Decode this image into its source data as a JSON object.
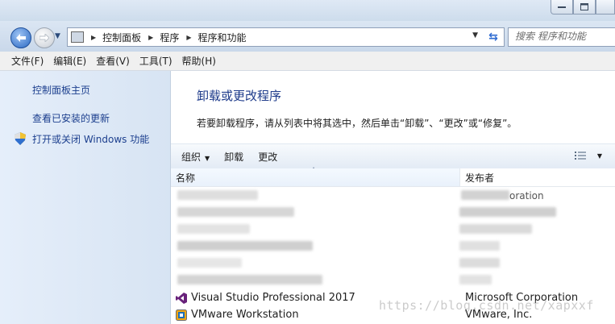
{
  "address_bar": {
    "crumbs": [
      "控制面板",
      "程序",
      "程序和功能"
    ]
  },
  "search": {
    "placeholder": "搜索 程序和功能"
  },
  "menu": [
    "文件(F)",
    "编辑(E)",
    "查看(V)",
    "工具(T)",
    "帮助(H)"
  ],
  "sidebar": {
    "items": [
      {
        "label": "控制面板主页"
      },
      {
        "label": "查看已安装的更新"
      },
      {
        "label": "打开或关闭 Windows 功能"
      }
    ]
  },
  "main": {
    "title": "卸载或更改程序",
    "description": "若要卸载程序，请从列表中将其选中，然后单击“卸载”、“更改”或“修复”。"
  },
  "toolbar": {
    "organize": "组织",
    "uninstall": "卸载",
    "change": "更改"
  },
  "columns": {
    "name": "名称",
    "publisher": "发布者"
  },
  "programs": [
    {
      "name": "Visual Studio Professional 2017",
      "publisher": "Microsoft Corporation",
      "icon": "visual-studio-icon"
    },
    {
      "name": "VMware Workstation",
      "publisher": "VMware, Inc.",
      "icon": "vmware-icon"
    }
  ],
  "obscured_publisher_fragment": "oration",
  "watermark": "https://blog.csdn.net/xapxxf",
  "colors": {
    "link": "#1c3f8e",
    "title": "#1d3a8a",
    "sidebar": "#dfe9f6"
  }
}
